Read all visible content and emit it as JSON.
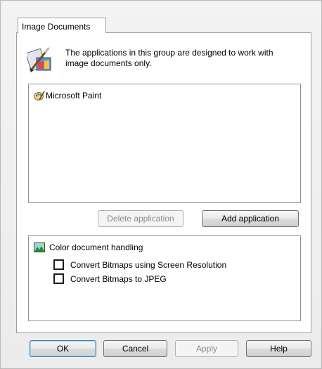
{
  "tab": {
    "label": "Image Documents"
  },
  "description": "The applications in this group are designed to work with image documents only.",
  "applications": [
    {
      "name": "Microsoft Paint",
      "icon": "paint-palette-icon"
    }
  ],
  "app_buttons": {
    "delete": "Delete application",
    "add": "Add application"
  },
  "options": {
    "header": "Color document handling",
    "items": [
      {
        "label": "Convert Bitmaps using Screen Resolution",
        "checked": false
      },
      {
        "label": "Convert Bitmaps to JPEG",
        "checked": false
      }
    ]
  },
  "dialog_buttons": {
    "ok": "OK",
    "cancel": "Cancel",
    "apply": "Apply",
    "help": "Help"
  },
  "colors": {
    "default_button_border": "#3c7fb1",
    "disabled_text": "#8a8a8a"
  }
}
